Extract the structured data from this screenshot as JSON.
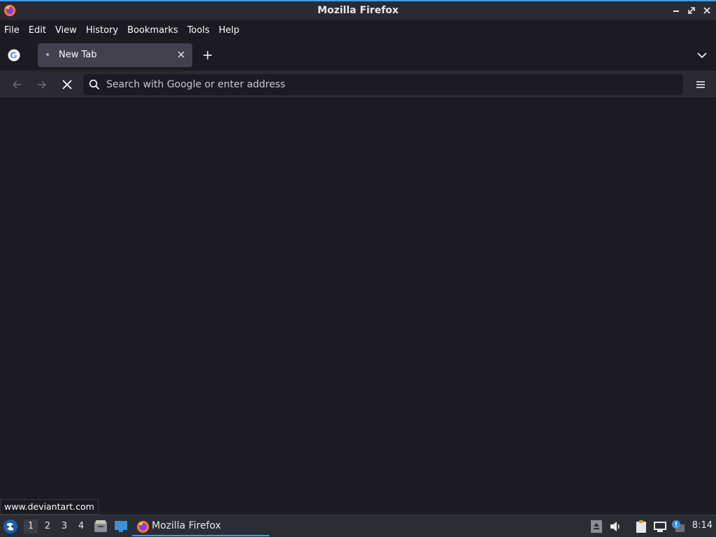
{
  "window": {
    "title": "Mozilla Firefox"
  },
  "menubar": {
    "items": [
      {
        "label": "File"
      },
      {
        "label": "Edit"
      },
      {
        "label": "View"
      },
      {
        "label": "History"
      },
      {
        "label": "Bookmarks"
      },
      {
        "label": "Tools"
      },
      {
        "label": "Help"
      }
    ]
  },
  "tabs": {
    "pinned": {
      "icon": "google-icon"
    },
    "active": {
      "title": "New Tab"
    }
  },
  "navbar": {
    "urlbar_placeholder": "Search with Google or enter address"
  },
  "status": {
    "link": "www.deviantart.com"
  },
  "taskbar": {
    "workspaces": [
      "1",
      "2",
      "3",
      "4"
    ],
    "active_workspace": "1",
    "task_label": "Mozilla Firefox",
    "clock": "8:14"
  },
  "colors": {
    "accent": "#3d9be9",
    "toolbar": "#2b2a33",
    "content": "#1c1b22",
    "tab_selected": "#42414d"
  }
}
